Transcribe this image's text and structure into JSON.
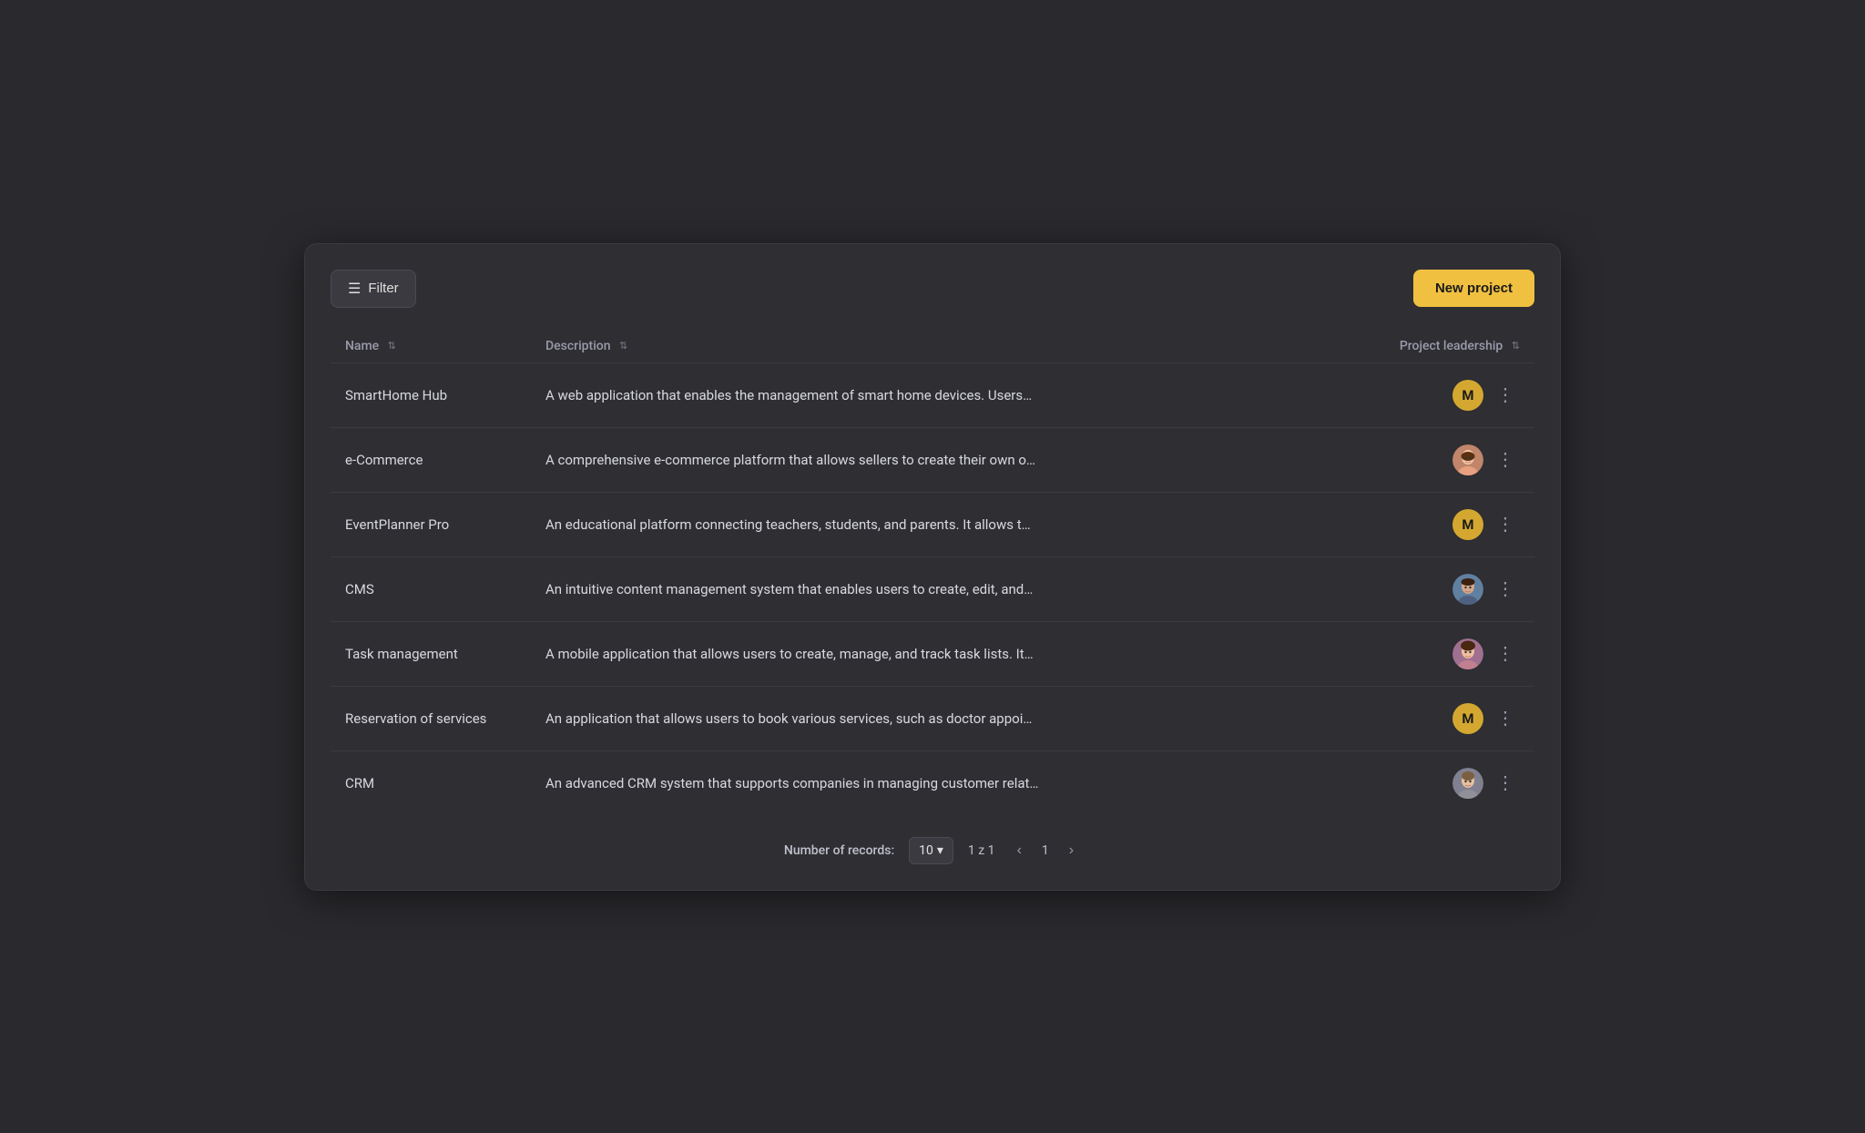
{
  "toolbar": {
    "filter_label": "Filter",
    "new_project_label": "New project"
  },
  "table": {
    "columns": [
      {
        "key": "name",
        "label": "Name"
      },
      {
        "key": "description",
        "label": "Description"
      },
      {
        "key": "leadership",
        "label": "Project leadership"
      }
    ],
    "rows": [
      {
        "id": 1,
        "name": "SmartHome Hub",
        "description": "A web application that enables the management of smart home devices. Users…",
        "leadership_type": "initial",
        "leadership_initial": "M",
        "leadership_color": "gold"
      },
      {
        "id": 2,
        "name": "e-Commerce",
        "description": "A comprehensive e-commerce platform that allows sellers to create their own o…",
        "leadership_type": "photo",
        "leadership_photo": "woman1"
      },
      {
        "id": 3,
        "name": "EventPlanner Pro",
        "description": "An educational platform connecting teachers, students, and parents. It allows t…",
        "leadership_type": "initial",
        "leadership_initial": "M",
        "leadership_color": "gold"
      },
      {
        "id": 4,
        "name": "CMS",
        "description": "An intuitive content management system that enables users to create, edit, and…",
        "leadership_type": "photo",
        "leadership_photo": "man1"
      },
      {
        "id": 5,
        "name": "Task management",
        "description": "A mobile application that allows users to create, manage, and track task lists. It…",
        "leadership_type": "photo",
        "leadership_photo": "woman2"
      },
      {
        "id": 6,
        "name": "Reservation of services",
        "description": "An application that allows users to book various services, such as doctor appoi…",
        "leadership_type": "initial",
        "leadership_initial": "M",
        "leadership_color": "gold"
      },
      {
        "id": 7,
        "name": "CRM",
        "description": "An advanced CRM system that supports companies in managing customer relat…",
        "leadership_type": "photo",
        "leadership_photo": "woman3"
      }
    ]
  },
  "pagination": {
    "records_label": "Number of records:",
    "records_value": "10",
    "page_info": "1 z 1",
    "current_page": "1"
  }
}
